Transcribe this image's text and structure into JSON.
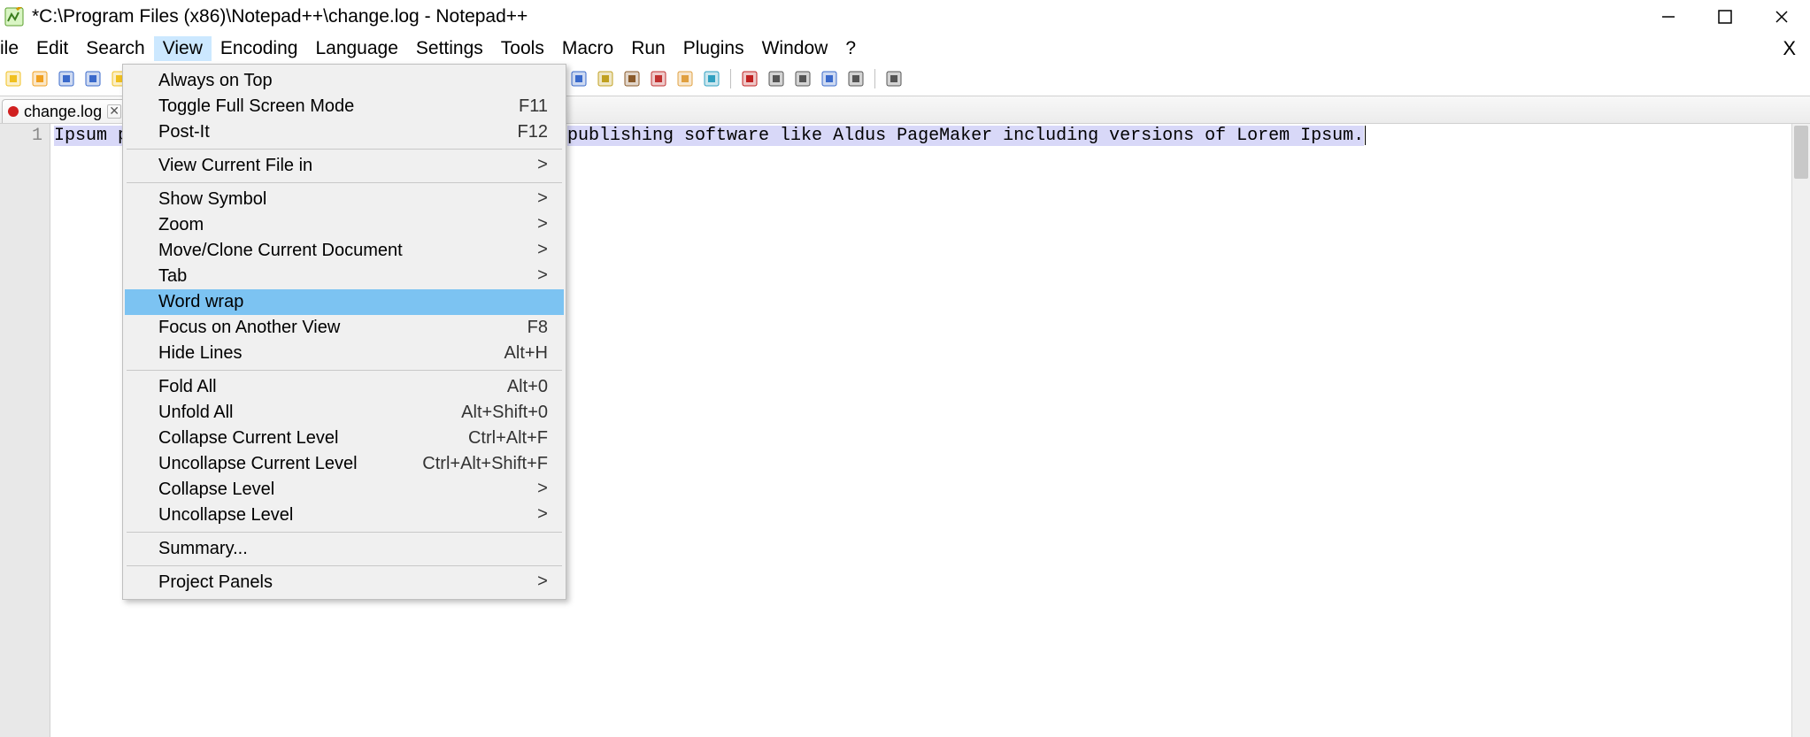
{
  "window": {
    "title": "*C:\\Program Files (x86)\\Notepad++\\change.log - Notepad++"
  },
  "menubar": {
    "items": [
      "File",
      "Edit",
      "Search",
      "View",
      "Encoding",
      "Language",
      "Settings",
      "Tools",
      "Macro",
      "Run",
      "Plugins",
      "Window",
      "?"
    ],
    "open_index": 3,
    "close_x": "X"
  },
  "toolbar_icons": [
    "new-file-icon",
    "open-file-icon",
    "save-icon",
    "save-all-icon",
    "close-icon",
    "close-all-icon",
    "print-icon",
    "cut-icon",
    "copy-icon",
    "paste-icon",
    "undo-icon",
    "redo-icon",
    "find-icon",
    "replace-icon",
    "zoom-in-icon",
    "zoom-out-icon",
    "sync-v-icon",
    "sync-h-icon",
    "word-wrap-icon",
    "all-chars-icon",
    "indent-guide-icon",
    "udl-icon",
    "doc-map-icon",
    "func-list-icon",
    "folder-icon",
    "monitor-icon",
    "record-icon",
    "stop-icon",
    "play-icon",
    "play-multi-icon",
    "save-macro-icon",
    "spell-icon"
  ],
  "tab": {
    "label": "change.log"
  },
  "editor": {
    "line_number": "1",
    "text_left": "Ipsum p",
    "text_right": "publishing software like Aldus PageMaker including versions of Lorem Ipsum."
  },
  "view_menu": {
    "items": [
      {
        "label": "Always on Top",
        "accel": "",
        "submenu": false,
        "highlight": false
      },
      {
        "label": "Toggle Full Screen Mode",
        "accel": "F11",
        "submenu": false,
        "highlight": false
      },
      {
        "label": "Post-It",
        "accel": "F12",
        "submenu": false,
        "highlight": false
      },
      {
        "sep": true
      },
      {
        "label": "View Current File in",
        "accel": "",
        "submenu": true,
        "highlight": false
      },
      {
        "sep": true
      },
      {
        "label": "Show Symbol",
        "accel": "",
        "submenu": true,
        "highlight": false
      },
      {
        "label": "Zoom",
        "accel": "",
        "submenu": true,
        "highlight": false
      },
      {
        "label": "Move/Clone Current Document",
        "accel": "",
        "submenu": true,
        "highlight": false
      },
      {
        "label": "Tab",
        "accel": "",
        "submenu": true,
        "highlight": false
      },
      {
        "label": "Word wrap",
        "accel": "",
        "submenu": false,
        "highlight": true
      },
      {
        "label": "Focus on Another View",
        "accel": "F8",
        "submenu": false,
        "highlight": false
      },
      {
        "label": "Hide Lines",
        "accel": "Alt+H",
        "submenu": false,
        "highlight": false
      },
      {
        "sep": true
      },
      {
        "label": "Fold All",
        "accel": "Alt+0",
        "submenu": false,
        "highlight": false
      },
      {
        "label": "Unfold All",
        "accel": "Alt+Shift+0",
        "submenu": false,
        "highlight": false
      },
      {
        "label": "Collapse Current Level",
        "accel": "Ctrl+Alt+F",
        "submenu": false,
        "highlight": false
      },
      {
        "label": "Uncollapse Current Level",
        "accel": "Ctrl+Alt+Shift+F",
        "submenu": false,
        "highlight": false
      },
      {
        "label": "Collapse Level",
        "accel": "",
        "submenu": true,
        "highlight": false
      },
      {
        "label": "Uncollapse Level",
        "accel": "",
        "submenu": true,
        "highlight": false
      },
      {
        "sep": true
      },
      {
        "label": "Summary...",
        "accel": "",
        "submenu": false,
        "highlight": false
      },
      {
        "sep": true
      },
      {
        "label": "Project Panels",
        "accel": "",
        "submenu": true,
        "highlight": false
      }
    ]
  }
}
